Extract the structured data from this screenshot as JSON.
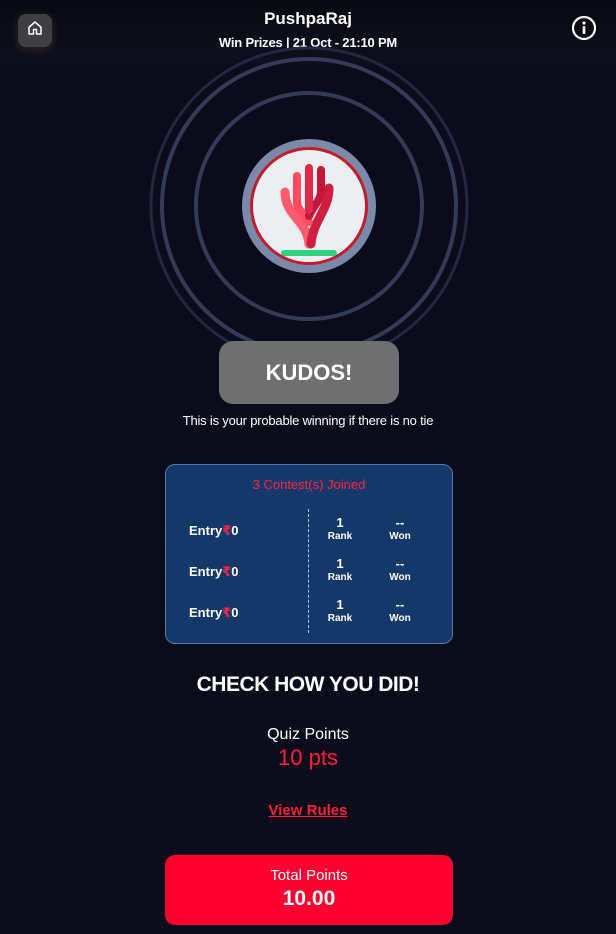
{
  "header": {
    "title": "PushpaRaj",
    "subtitle": "Win Prizes | 21 Oct - 21:10 PM",
    "home_icon": "home-icon",
    "info_icon": "info-icon"
  },
  "result": {
    "banner": "KUDOS!",
    "note": "This is your probable winning if there is no tie"
  },
  "contests": {
    "title": "3 Contest(s) Joined",
    "entry_label": "Entry",
    "currency_symbol": "₹",
    "rows": [
      {
        "entry": "0",
        "rank": "1",
        "rank_label": "Rank",
        "won": "--",
        "won_label": "Won"
      },
      {
        "entry": "0",
        "rank": "1",
        "rank_label": "Rank",
        "won": "--",
        "won_label": "Won"
      },
      {
        "entry": "0",
        "rank": "1",
        "rank_label": "Rank",
        "won": "--",
        "won_label": "Won"
      }
    ]
  },
  "summary": {
    "heading": "CHECK HOW YOU DID!",
    "quiz_points_label": "Quiz Points",
    "quiz_points_value": "10 pts",
    "rules_link": "View Rules",
    "total_label": "Total Points",
    "total_value": "10.00"
  },
  "colors": {
    "background": "#0b0c1b",
    "accent_red": "#ff0030",
    "card_blue": "#15386b",
    "banner_gray": "#6f6f70"
  }
}
